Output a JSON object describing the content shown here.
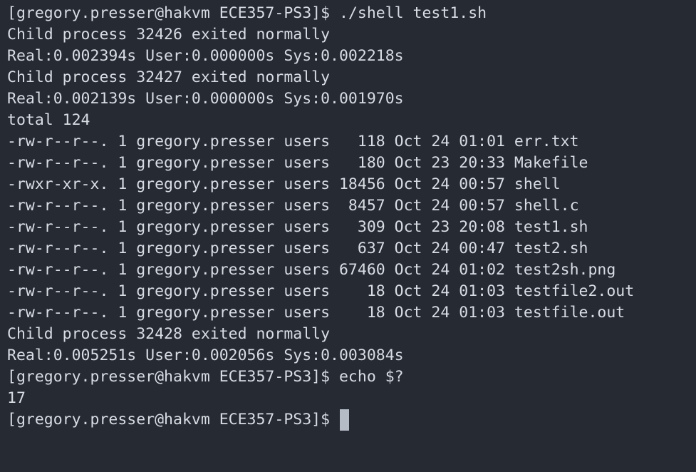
{
  "terminal": {
    "lines": [
      "[gregory.presser@hakvm ECE357-PS3]$ ./shell test1.sh",
      "Child process 32426 exited normally",
      "Real:0.002394s User:0.000000s Sys:0.002218s",
      "Child process 32427 exited normally",
      "Real:0.002139s User:0.000000s Sys:0.001970s",
      "total 124",
      "-rw-r--r--. 1 gregory.presser users   118 Oct 24 01:01 err.txt",
      "-rw-r--r--. 1 gregory.presser users   180 Oct 23 20:33 Makefile",
      "-rwxr-xr-x. 1 gregory.presser users 18456 Oct 24 00:57 shell",
      "-rw-r--r--. 1 gregory.presser users  8457 Oct 24 00:57 shell.c",
      "-rw-r--r--. 1 gregory.presser users   309 Oct 23 20:08 test1.sh",
      "-rw-r--r--. 1 gregory.presser users   637 Oct 24 00:47 test2.sh",
      "-rw-r--r--. 1 gregory.presser users 67460 Oct 24 01:02 test2sh.png",
      "-rw-r--r--. 1 gregory.presser users    18 Oct 24 01:03 testfile2.out",
      "-rw-r--r--. 1 gregory.presser users    18 Oct 24 01:03 testfile.out",
      "Child process 32428 exited normally",
      "Real:0.005251s User:0.002056s Sys:0.003084s",
      "[gregory.presser@hakvm ECE357-PS3]$ echo $?",
      "17"
    ],
    "prompt": "[gregory.presser@hakvm ECE357-PS3]$ ",
    "colors": {
      "background": "#262a33",
      "foreground": "#d8dce3",
      "cursor": "#b6bcc6"
    }
  }
}
